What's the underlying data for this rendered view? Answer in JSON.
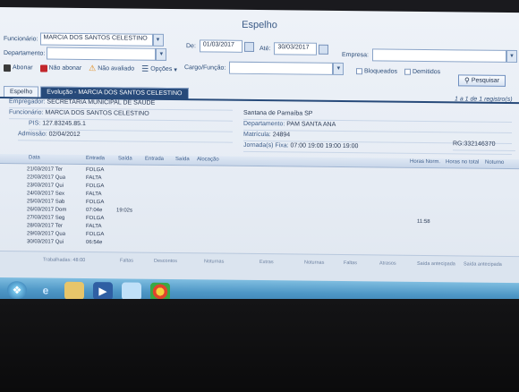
{
  "window": {
    "title": "Espelho"
  },
  "filters": {
    "funcionario_label": "Funcionário:",
    "funcionario_value": "MARCIA DOS SANTOS CELESTINO",
    "departamento_label": "Departamento:",
    "departamento_value": "",
    "de_label": "De:",
    "de_value": "01/03/2017",
    "ate_label": "Até:",
    "ate_value": "30/03/2017",
    "empresa_label": "Empresa:",
    "empresa_value": "",
    "cargo_label": "Cargo/Função:",
    "cargo_value": "",
    "bloqueados_label": "Bloqueados",
    "demitidos_label": "Demitidos",
    "pesquisar_label": "Pesquisar"
  },
  "toolbar": {
    "abonar": "Abonar",
    "nao_abonar": "Não abonar",
    "nao_avaliado": "Não avaliado",
    "opcoes": "Opções"
  },
  "tabs": [
    "Espelho",
    "Evolução - MARCIA DOS SANTOS CELESTINO"
  ],
  "pager": "1 a 1 de 1 registro(s)",
  "info": {
    "empregador_k": "Empregador:",
    "empregador_v": "SECRETARIA MUNICIPAL DE SAUDE",
    "funcionario_k": "Funcionário:",
    "funcionario_v": "MARCIA DOS SANTOS CELESTINO",
    "pis_k": "PIS:",
    "pis_v": "127.83245.85.1",
    "admissao_k": "Admissão:",
    "admissao_v": "02/04/2012",
    "cidade_v": "Santana de Parnaíba SP",
    "departamento_k": "Departamento:",
    "departamento_v": "PAM SANTA ANA",
    "matricula_k": "Matrícula:",
    "matricula_v": "24894",
    "jornada_k": "Jornada(s) Fixa:",
    "jornada_v": "07:00 19:00 19:00 19:00",
    "rg_v": "RG:332146370"
  },
  "grid": {
    "headers": [
      "Data",
      "Entrada",
      "Saída",
      "Entrada",
      "Saída",
      "Alocação"
    ],
    "right_headers": [
      "Horas Norm.",
      "Horas no total",
      "Noturno"
    ],
    "rows": [
      {
        "date": "21/03/2017 Ter",
        "c1": "FOLGA",
        "c2": "",
        "extra": ""
      },
      {
        "date": "22/03/2017 Qua",
        "c1": "FALTA",
        "c2": "",
        "extra": ""
      },
      {
        "date": "23/03/2017 Qui",
        "c1": "FOLGA",
        "c2": "",
        "extra": ""
      },
      {
        "date": "24/03/2017 Sex",
        "c1": "FALTA",
        "c2": "",
        "extra": ""
      },
      {
        "date": "25/03/2017 Sab",
        "c1": "FOLGA",
        "c2": "",
        "extra": ""
      },
      {
        "date": "26/03/2017 Dom",
        "c1": "07:04e",
        "c2": "19:02s",
        "extra": ""
      },
      {
        "date": "27/03/2017 Seg",
        "c1": "FOLGA",
        "c2": "",
        "extra": "11:58"
      },
      {
        "date": "28/03/2017 Ter",
        "c1": "FALTA",
        "c2": "",
        "extra": ""
      },
      {
        "date": "29/03/2017 Qua",
        "c1": "FOLGA",
        "c2": "",
        "extra": ""
      },
      {
        "date": "30/03/2017 Qui",
        "c1": "06:54e",
        "c2": "",
        "extra": ""
      }
    ]
  },
  "footer": {
    "items": [
      "Trabalhadas: 48:00",
      "Faltas",
      "Descontos",
      "Noturnas",
      "Extras",
      "Noturnas",
      "Faltas",
      "Atrasos",
      "Saída antecipada",
      "Saída antecipada"
    ]
  }
}
